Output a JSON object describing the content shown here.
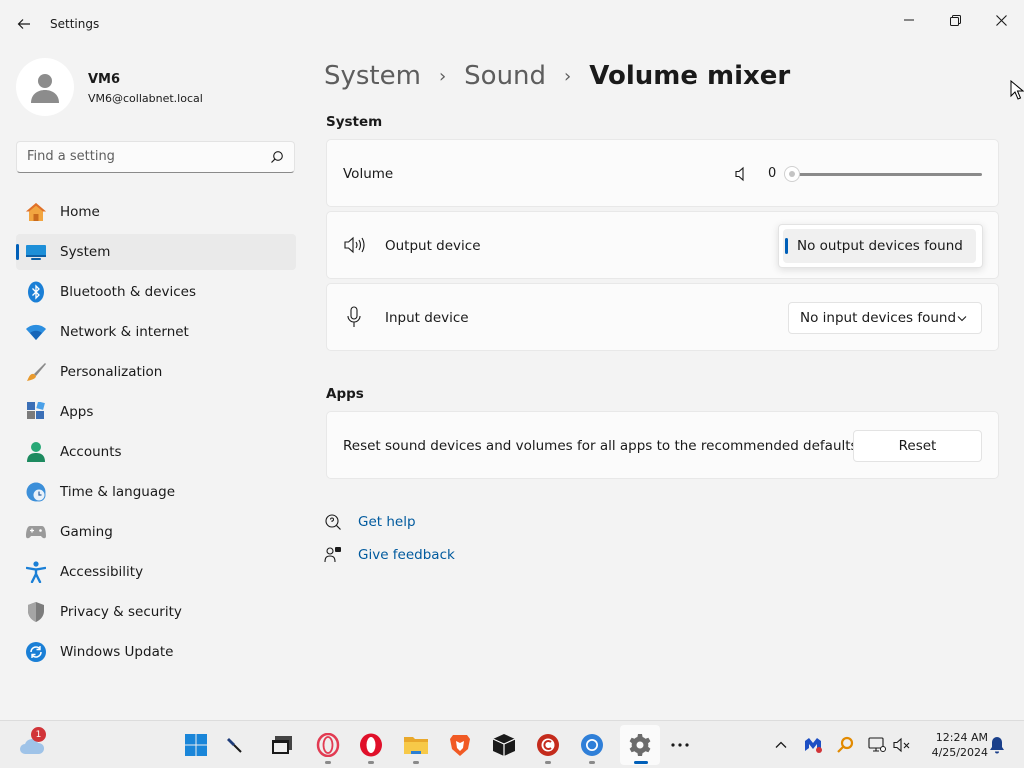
{
  "window": {
    "title": "Settings"
  },
  "user": {
    "name": "VM6",
    "email": "VM6@collabnet.local"
  },
  "search": {
    "placeholder": "Find a setting"
  },
  "nav": [
    {
      "label": "Home",
      "icon": "home-icon"
    },
    {
      "label": "System",
      "icon": "system-icon",
      "active": true
    },
    {
      "label": "Bluetooth & devices",
      "icon": "bluetooth-icon"
    },
    {
      "label": "Network & internet",
      "icon": "wifi-icon"
    },
    {
      "label": "Personalization",
      "icon": "brush-icon"
    },
    {
      "label": "Apps",
      "icon": "apps-icon"
    },
    {
      "label": "Accounts",
      "icon": "accounts-icon"
    },
    {
      "label": "Time & language",
      "icon": "clock-globe-icon"
    },
    {
      "label": "Gaming",
      "icon": "gamepad-icon"
    },
    {
      "label": "Accessibility",
      "icon": "accessibility-icon"
    },
    {
      "label": "Privacy & security",
      "icon": "shield-icon"
    },
    {
      "label": "Windows Update",
      "icon": "update-icon"
    }
  ],
  "breadcrumb": {
    "level1": "System",
    "level2": "Sound",
    "current": "Volume mixer"
  },
  "system_section": {
    "heading": "System",
    "volume": {
      "label": "Volume",
      "value": "0",
      "level": 0
    },
    "output": {
      "label": "Output device",
      "selected": "No output devices found"
    },
    "input": {
      "label": "Input device",
      "selected": "No input devices found"
    }
  },
  "apps_section": {
    "heading": "Apps",
    "reset_text": "Reset sound devices and volumes for all apps to the recommended defaults",
    "reset_button": "Reset"
  },
  "links": {
    "help": "Get help",
    "feedback": "Give feedback"
  },
  "taskbar": {
    "weather_badge": "1",
    "time": "12:24 AM",
    "date": "4/25/2024"
  },
  "colors": {
    "accent": "#005fb8",
    "link": "#005a9e"
  }
}
